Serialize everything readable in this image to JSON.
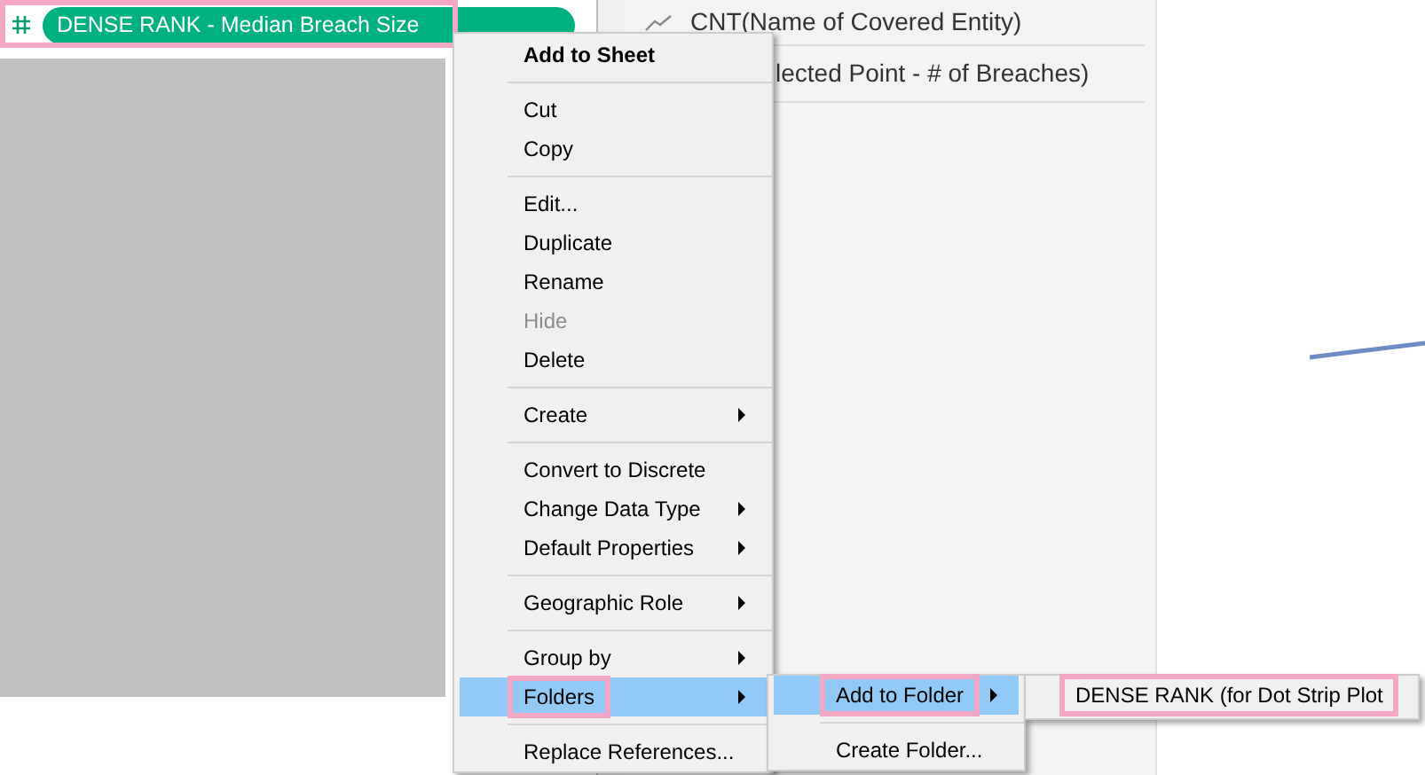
{
  "field_pill": {
    "label": "DENSE RANK - Median Breach Size",
    "highlighted": true
  },
  "shelf_rows": [
    {
      "kind": "line",
      "label": "CNT(Name of Covered Entity)"
    },
    {
      "kind": "plain",
      "label": "lected Point - # of Breaches)"
    }
  ],
  "context_menu": [
    {
      "kind": "item",
      "label": "Add to Sheet",
      "bold": true,
      "disabled": false,
      "submenu": false,
      "selected": false,
      "highlighted": false
    },
    {
      "kind": "separator"
    },
    {
      "kind": "item",
      "label": "Cut",
      "bold": false,
      "disabled": false,
      "submenu": false,
      "selected": false,
      "highlighted": false
    },
    {
      "kind": "item",
      "label": "Copy",
      "bold": false,
      "disabled": false,
      "submenu": false,
      "selected": false,
      "highlighted": false
    },
    {
      "kind": "separator"
    },
    {
      "kind": "item",
      "label": "Edit...",
      "bold": false,
      "disabled": false,
      "submenu": false,
      "selected": false,
      "highlighted": false
    },
    {
      "kind": "item",
      "label": "Duplicate",
      "bold": false,
      "disabled": false,
      "submenu": false,
      "selected": false,
      "highlighted": false
    },
    {
      "kind": "item",
      "label": "Rename",
      "bold": false,
      "disabled": false,
      "submenu": false,
      "selected": false,
      "highlighted": false
    },
    {
      "kind": "item",
      "label": "Hide",
      "bold": false,
      "disabled": true,
      "submenu": false,
      "selected": false,
      "highlighted": false
    },
    {
      "kind": "item",
      "label": "Delete",
      "bold": false,
      "disabled": false,
      "submenu": false,
      "selected": false,
      "highlighted": false
    },
    {
      "kind": "separator"
    },
    {
      "kind": "item",
      "label": "Create",
      "bold": false,
      "disabled": false,
      "submenu": true,
      "selected": false,
      "highlighted": false
    },
    {
      "kind": "separator"
    },
    {
      "kind": "item",
      "label": "Convert to Discrete",
      "bold": false,
      "disabled": false,
      "submenu": false,
      "selected": false,
      "highlighted": false
    },
    {
      "kind": "item",
      "label": "Change Data Type",
      "bold": false,
      "disabled": false,
      "submenu": true,
      "selected": false,
      "highlighted": false
    },
    {
      "kind": "item",
      "label": "Default Properties",
      "bold": false,
      "disabled": false,
      "submenu": true,
      "selected": false,
      "highlighted": false
    },
    {
      "kind": "separator"
    },
    {
      "kind": "item",
      "label": "Geographic Role",
      "bold": false,
      "disabled": false,
      "submenu": true,
      "selected": false,
      "highlighted": false
    },
    {
      "kind": "separator"
    },
    {
      "kind": "item",
      "label": "Group by",
      "bold": false,
      "disabled": false,
      "submenu": true,
      "selected": false,
      "highlighted": false
    },
    {
      "kind": "item",
      "label": "Folders",
      "bold": false,
      "disabled": false,
      "submenu": true,
      "selected": true,
      "highlighted": true
    },
    {
      "kind": "separator"
    },
    {
      "kind": "item",
      "label": "Replace References...",
      "bold": false,
      "disabled": false,
      "submenu": false,
      "selected": false,
      "highlighted": false
    }
  ],
  "folders_submenu": [
    {
      "kind": "item",
      "label": "Add to Folder",
      "bold": false,
      "disabled": false,
      "submenu": true,
      "selected": true,
      "highlighted": true
    },
    {
      "kind": "separator"
    },
    {
      "kind": "item",
      "label": "Create Folder...",
      "bold": false,
      "disabled": false,
      "submenu": false,
      "selected": false,
      "highlighted": false
    }
  ],
  "add_to_folder_submenu": [
    {
      "kind": "item",
      "label": "DENSE RANK (for Dot Strip Plot",
      "bold": false,
      "disabled": false,
      "submenu": false,
      "selected": false,
      "highlighted": true
    }
  ]
}
